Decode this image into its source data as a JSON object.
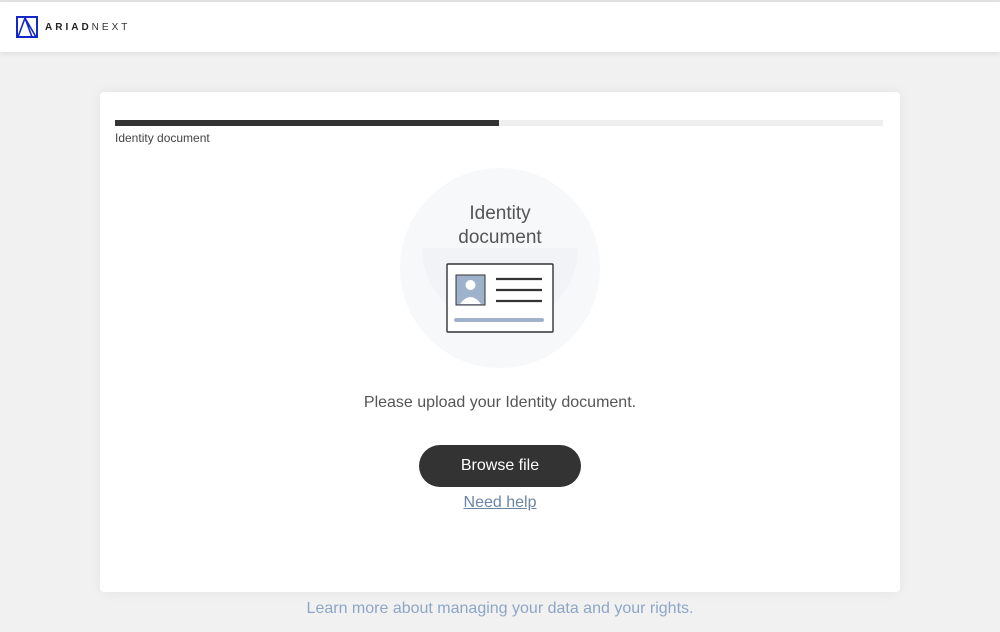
{
  "header": {
    "logo_bold": "ARIAD",
    "logo_light": "NEXT",
    "logo_icon": "ariadnext-logo-icon"
  },
  "progress": {
    "fraction": 0.5,
    "step_label": "Identity document"
  },
  "upload": {
    "title_line1": "Identity",
    "title_line2": "document",
    "card_icon": "id-card-icon",
    "instruction": "Please upload your Identity document.",
    "browse_label": "Browse file",
    "help_label": "Need help"
  },
  "footer": {
    "privacy_link": "Learn more about managing your data and your rights."
  },
  "colors": {
    "accent_dark": "#333333",
    "link": "#6c84a6",
    "footer_link": "#8ea6c6",
    "logo_blue": "#1428c8",
    "card_blue": "#9fb2cb"
  }
}
